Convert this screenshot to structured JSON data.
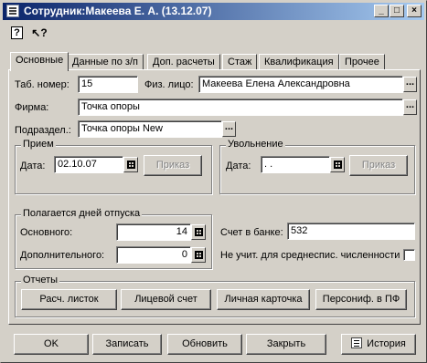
{
  "window": {
    "title": "Сотрудник:Макеева Е. А. (13.12.07)"
  },
  "title_buttons": {
    "minimize": "_",
    "maximize": "□",
    "close": "×"
  },
  "toolbar": {
    "help": "?",
    "whats_this": "↖?"
  },
  "tabs": [
    {
      "label": "Основные",
      "active": true
    },
    {
      "label": "Данные по з/п"
    },
    {
      "label": "Доп. расчеты"
    },
    {
      "label": "Стаж"
    },
    {
      "label": "Квалификация"
    },
    {
      "label": "Прочее"
    }
  ],
  "main": {
    "tab_number_label": "Таб. номер:",
    "tab_number": "15",
    "person_label": "Физ. лицо:",
    "person": "Макеева Елена Александровна",
    "firm_label": "Фирма:",
    "firm": "Точка опоры",
    "division_label": "Подраздел.:",
    "division": "Точка опоры New",
    "ellipsis": "..."
  },
  "hire": {
    "title": "Прием",
    "date_label": "Дата:",
    "date": "02.10.07",
    "order_button": "Приказ"
  },
  "dismissal": {
    "title": "Увольнение",
    "date_label": "Дата:",
    "date": " .  .",
    "order_button": "Приказ"
  },
  "vacation": {
    "title": "Полагается  дней отпуска",
    "main_label": "Основного:",
    "main_value": "14",
    "extra_label": "Дополнительного:",
    "extra_value": "0"
  },
  "bank": {
    "account_label": "Счет в банке:",
    "account": "532"
  },
  "headcount": {
    "label": "Не учит. для среднеспис. численности",
    "checked": false
  },
  "reports": {
    "title": "Отчеты",
    "payslip": "Расч. листок",
    "personal_account": "Лицевой счет",
    "personal_card": "Личная карточка",
    "pension": "Персониф. в ПФ"
  },
  "footer": {
    "ok": "OK",
    "save": "Записать",
    "refresh": "Обновить",
    "close": "Закрыть",
    "history": "История"
  }
}
